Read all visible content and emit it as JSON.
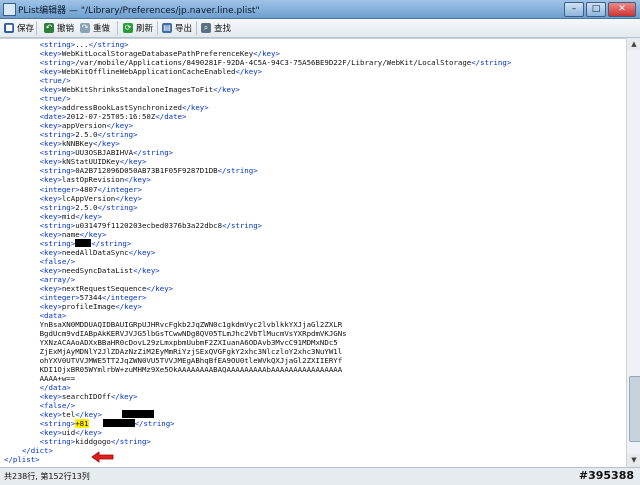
{
  "window": {
    "title": "PList编辑器 — \"/Library/Preferences/jp.naver.line.plist\"",
    "controls": {
      "minimize": "–",
      "maximize": "□",
      "close": "✕"
    }
  },
  "toolbar": {
    "save": "保存",
    "undo": "撤销",
    "redo": "重做",
    "refresh": "刷新",
    "export": "导出",
    "find": "查找"
  },
  "editor": {
    "lines": [
      {
        "indent": 2,
        "tag": "string",
        "text": "...",
        "cut": true
      },
      {
        "indent": 2,
        "tag": "key",
        "text": "WebKitLocalStorageDatabasePathPreferenceKey"
      },
      {
        "indent": 2,
        "tag": "string",
        "text": "/var/mobile/Applications/8490281F-92DA-4C5A-94C3-75A56BE9D22F/Library/WebKit/LocalStorage"
      },
      {
        "indent": 2,
        "tag": "key",
        "text": "WebKitOfflineWebApplicationCacheEnabled"
      },
      {
        "indent": 2,
        "selfclose": "true"
      },
      {
        "indent": 2,
        "tag": "key",
        "text": "WebKitShrinksStandaloneImagesToFit"
      },
      {
        "indent": 2,
        "selfclose": "true"
      },
      {
        "indent": 2,
        "tag": "key",
        "text": "addressBookLastSynchronized"
      },
      {
        "indent": 2,
        "tag": "date",
        "text": "2012-07-25T05:16:50Z"
      },
      {
        "indent": 2,
        "tag": "key",
        "text": "appVersion"
      },
      {
        "indent": 2,
        "tag": "string",
        "text": "2.5.0"
      },
      {
        "indent": 2,
        "tag": "key",
        "text": "kNNBKey"
      },
      {
        "indent": 2,
        "tag": "string",
        "text": "UU3OSBJABIHVA"
      },
      {
        "indent": 2,
        "tag": "key",
        "text": "kNStatUUIDKey"
      },
      {
        "indent": 2,
        "tag": "string",
        "text": "0A2B712096D050AB73B1F05F9287D1DB"
      },
      {
        "indent": 2,
        "tag": "key",
        "text": "lastOpRevision"
      },
      {
        "indent": 2,
        "tag": "integer",
        "text": "4807"
      },
      {
        "indent": 2,
        "tag": "key",
        "text": "lcAppVersion"
      },
      {
        "indent": 2,
        "tag": "string",
        "text": "2.5.0"
      },
      {
        "indent": 2,
        "tag": "key",
        "text": "mid"
      },
      {
        "indent": 2,
        "tag": "string",
        "text": "u031479f1120203ecbed0376b3a22dbc8"
      },
      {
        "indent": 2,
        "tag": "key",
        "text": "name"
      },
      {
        "indent": 2,
        "tag": "string",
        "text": "",
        "redacted": true
      },
      {
        "indent": 2,
        "tag": "key",
        "text": "needAllDataSync"
      },
      {
        "indent": 2,
        "selfclose": "false"
      },
      {
        "indent": 2,
        "tag": "key",
        "text": "needSyncDataList"
      },
      {
        "indent": 2,
        "selfclose": "array"
      },
      {
        "indent": 2,
        "tag": "key",
        "text": "nextRequestSequence"
      },
      {
        "indent": 2,
        "tag": "integer",
        "text": "57344"
      },
      {
        "indent": 2,
        "tag": "key",
        "text": "profileImage"
      },
      {
        "indent": 2,
        "open": "data"
      },
      {
        "indent": 2,
        "raw": "YnBsaXN0MDDUAQIDBAUIGRpUJHRvcFgkb2JqZWN0c1gkdmVyc2lvblkkYXJjaGl2ZXLR"
      },
      {
        "indent": 2,
        "raw": "BgdUcm9vdIABpAkKERVJVJG5lbGsTCwwNDg8QV05TLmJhc2VbTlMucmVsYXRpdmVKJGNs"
      },
      {
        "indent": 2,
        "raw": "YXNzACAAoADXxBBaHR0cDovL29zLmxpbmUubmF2ZXIuanA6ODAvb3MvcC91MDMxNDc5"
      },
      {
        "indent": 2,
        "raw": "ZjExMjAyMDNlY2JlZDAzNzZiM2EyMmRiYzjSExQVGFgkY2xhc3NlczloY2xhc3NuYW1l"
      },
      {
        "indent": 2,
        "raw": "ohYXV0UTVVJMWE5TT2JqZWN0VU5TVVJMEgABhqBfEA9OU0tleWVkQXJjaGl2ZXIIERYf"
      },
      {
        "indent": 2,
        "raw": "KDI1OjxBR05WYmlrbW+zuMHMz9Xe5OkAAAAAAAABAQAAAAAAAAAbAAAAAAAAAAAAAAAA"
      },
      {
        "indent": 2,
        "raw": "AAAA+w=="
      },
      {
        "indent": 2,
        "close": "data"
      },
      {
        "indent": 2,
        "tag": "key",
        "text": "searchIDOff"
      },
      {
        "indent": 2,
        "selfclose": "false"
      },
      {
        "indent": 2,
        "tag": "key",
        "text": "tel",
        "redactedAfter": true
      },
      {
        "indent": 2,
        "tag": "string",
        "text": "+81",
        "highlight": true,
        "redactedAfter": true
      },
      {
        "indent": 2,
        "tag": "key",
        "text": "uid"
      },
      {
        "indent": 2,
        "tag": "string",
        "text": "kiddgogo"
      },
      {
        "indent": 1,
        "close": "dict"
      },
      {
        "indent": 0,
        "close": "plist"
      }
    ]
  },
  "status": {
    "text": "共238行, 第152行13列"
  },
  "watermark": "#395388"
}
